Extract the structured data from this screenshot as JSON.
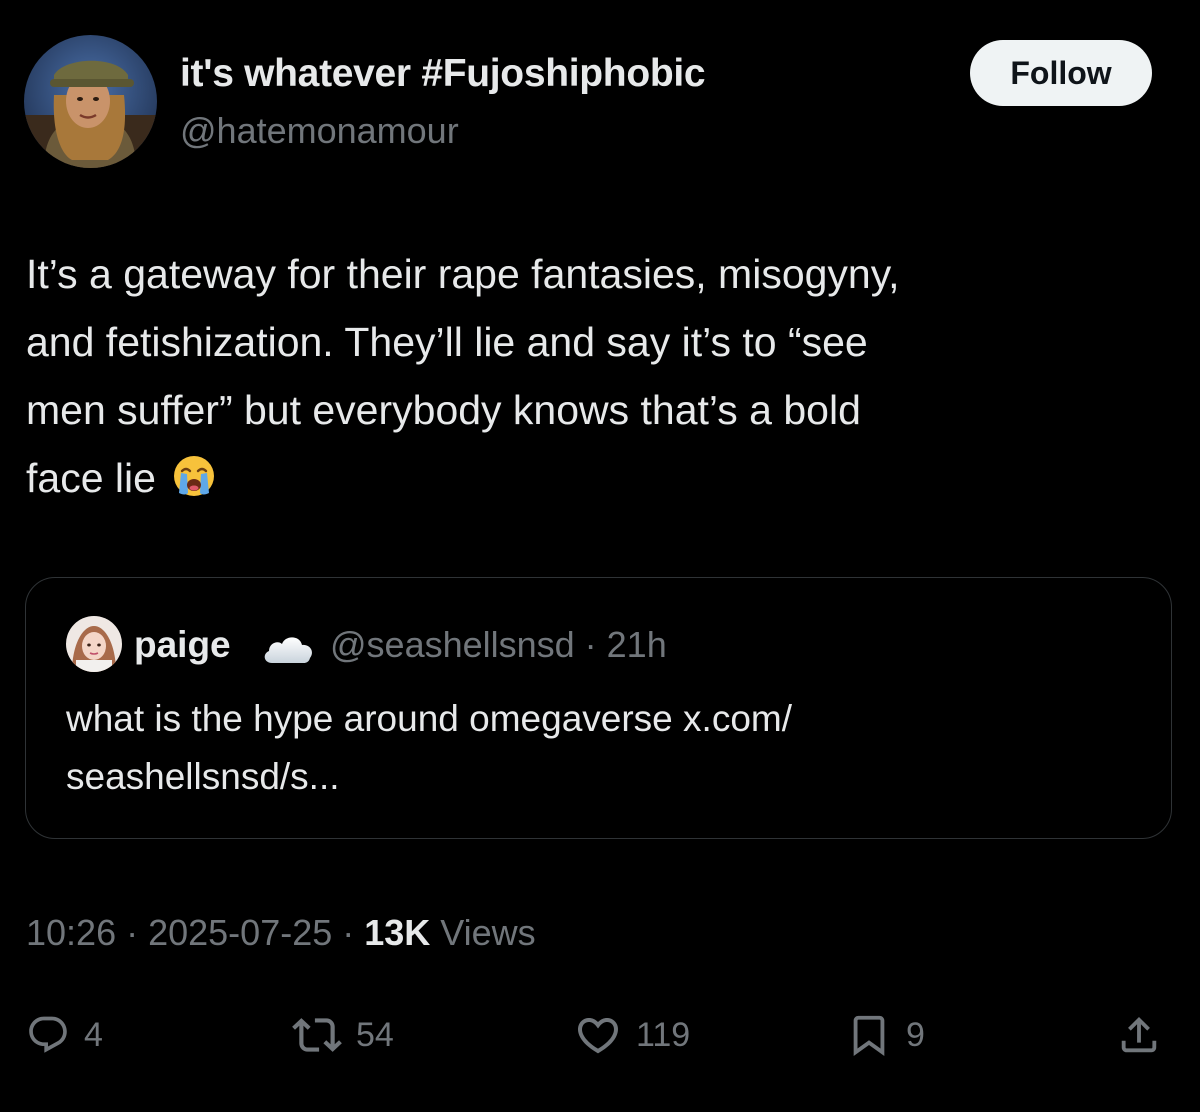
{
  "author": {
    "display_name": "it's whatever #Fujoshiphobic",
    "handle": "@hatemonamour",
    "avatar_icon": "profile-photo"
  },
  "follow_button": {
    "label": "Follow"
  },
  "tweet": {
    "lines": [
      "It’s a gateway for their rape fantasies, misogyny,",
      "and fetishization. They’ll lie and say it’s to “see",
      "men suffer” but everybody knows that’s a bold",
      "face lie"
    ],
    "emoji": "loudly-crying-face"
  },
  "quoted_tweet": {
    "name": "paige",
    "name_emoji": "cloud-icon",
    "handle_time": "@seashellsnsd · 21h",
    "lines": [
      "what is the hype around omegaverse x.com/",
      "seashellsnsd/s..."
    ]
  },
  "meta": {
    "time": "10:26",
    "sep1": " · ",
    "date": "2025-07-25",
    "sep2": " · ",
    "views_count": "13K",
    "views_label": " Views"
  },
  "actions": {
    "replies": "4",
    "reposts": "54",
    "likes": "119",
    "bookmarks": "9"
  },
  "colors": {
    "background": "#000000",
    "text": "#e7e9ea",
    "muted": "#71767b",
    "border": "#2f3336",
    "button_bg": "#eff3f4"
  }
}
